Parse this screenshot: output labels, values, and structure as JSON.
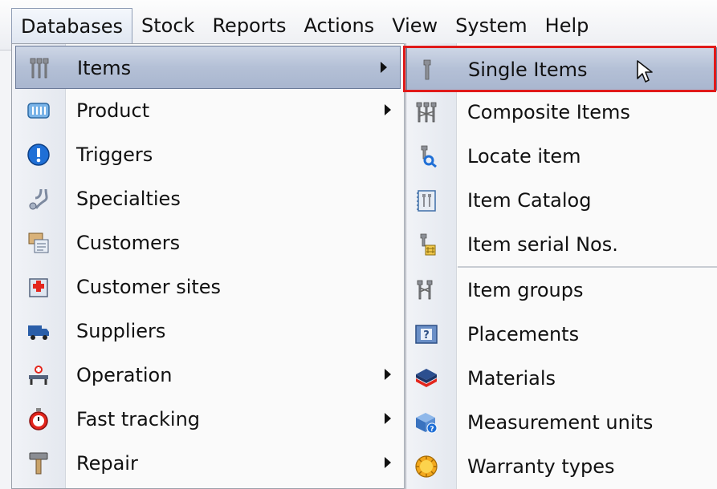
{
  "menubar": {
    "items": [
      "Databases",
      "Stock",
      "Reports",
      "Actions",
      "View",
      "System",
      "Help"
    ],
    "active": "Databases"
  },
  "databases_menu": {
    "items": [
      {
        "label": "Items",
        "icon": "items-icon",
        "has_submenu": true,
        "highlighted": true
      },
      {
        "label": "Product",
        "icon": "product-icon",
        "has_submenu": true
      },
      {
        "label": "Triggers",
        "icon": "info-icon",
        "has_submenu": false
      },
      {
        "label": "Specialties",
        "icon": "stethoscope-icon",
        "has_submenu": false
      },
      {
        "label": "Customers",
        "icon": "customers-icon",
        "has_submenu": false
      },
      {
        "label": "Customer sites",
        "icon": "hospital-icon",
        "has_submenu": false
      },
      {
        "label": "Suppliers",
        "icon": "truck-icon",
        "has_submenu": false
      },
      {
        "label": "Operation",
        "icon": "operation-icon",
        "has_submenu": true
      },
      {
        "label": "Fast tracking",
        "icon": "stopwatch-icon",
        "has_submenu": true
      },
      {
        "label": "Repair",
        "icon": "hammer-icon",
        "has_submenu": true
      }
    ]
  },
  "items_submenu": {
    "items": [
      {
        "label": "Single Items",
        "icon": "single-item-icon",
        "highlighted": true
      },
      {
        "label": "Composite Items",
        "icon": "composite-items-icon"
      },
      {
        "label": "Locate item",
        "icon": "locate-item-icon"
      },
      {
        "label": "Item Catalog",
        "icon": "catalog-icon"
      },
      {
        "label": "Item serial Nos.",
        "icon": "serial-icon"
      },
      {
        "label": "Item groups",
        "icon": "item-groups-icon"
      },
      {
        "label": "Placements",
        "icon": "placements-icon"
      },
      {
        "label": "Materials",
        "icon": "materials-icon"
      },
      {
        "label": "Measurement units",
        "icon": "measurement-icon"
      },
      {
        "label": "Warranty types",
        "icon": "warranty-icon"
      }
    ]
  },
  "colors": {
    "highlight": "#b4c0d6",
    "callout": "#e01a1a",
    "info_blue": "#1f6fd6",
    "stopwatch_red": "#e3261d"
  }
}
